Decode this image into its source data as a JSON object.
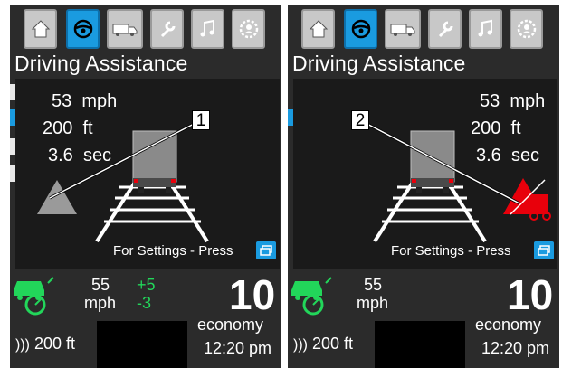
{
  "tabs": [
    {
      "icon": "home-icon"
    },
    {
      "icon": "steering-wheel-icon"
    },
    {
      "icon": "truck-icon"
    },
    {
      "icon": "wrench-icon"
    },
    {
      "icon": "music-note-icon"
    },
    {
      "icon": "gear-person-icon"
    }
  ],
  "colors": {
    "accent": "#1a9be0",
    "warning": "#e8000b",
    "green": "#22d65a",
    "background": "#2b2b2b"
  },
  "left": {
    "title": "Driving Assistance",
    "speed": "53",
    "speed_unit": "mph",
    "distance": "200",
    "distance_unit": "ft",
    "time_gap": "3.6",
    "time_unit": "sec",
    "callout": "1",
    "settings_text": "For Settings - Press",
    "set_speed": "55",
    "set_speed_unit": "mph",
    "plus": "+5",
    "minus": "-3",
    "big_value": "10",
    "mode": "economy",
    "time": "12:20 pm",
    "follow_distance": "200 ft"
  },
  "right": {
    "title": "Driving Assistance",
    "speed": "53",
    "speed_unit": "mph",
    "distance": "200",
    "distance_unit": "ft",
    "time_gap": "3.6",
    "time_unit": "sec",
    "callout": "2",
    "settings_text": "For Settings - Press",
    "set_speed": "55",
    "set_speed_unit": "mph",
    "big_value": "10",
    "mode": "economy",
    "time": "12:20 pm",
    "follow_distance": "200 ft"
  }
}
